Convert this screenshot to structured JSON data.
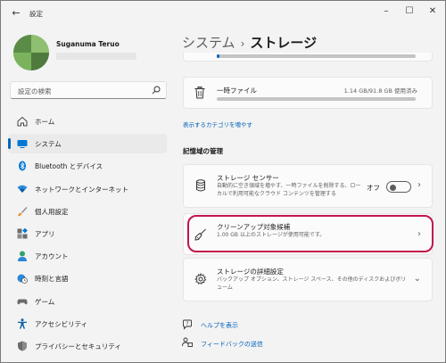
{
  "titlebar": {
    "back_glyph": "←",
    "title": "設定",
    "minimize_glyph": "–",
    "maximize_glyph": "☐",
    "close_glyph": "✕"
  },
  "profile": {
    "name": "Suganuma Teruo"
  },
  "search": {
    "placeholder": "設定の検索"
  },
  "nav": {
    "items": [
      {
        "label": "ホーム",
        "icon": "home-icon"
      },
      {
        "label": "システム",
        "icon": "system-icon",
        "active": true
      },
      {
        "label": "Bluetooth とデバイス",
        "icon": "bluetooth-icon"
      },
      {
        "label": "ネットワークとインターネット",
        "icon": "wifi-icon"
      },
      {
        "label": "個人用設定",
        "icon": "brush-icon"
      },
      {
        "label": "アプリ",
        "icon": "apps-icon"
      },
      {
        "label": "アカウント",
        "icon": "account-icon"
      },
      {
        "label": "時刻と言語",
        "icon": "globe-clock-icon"
      },
      {
        "label": "ゲーム",
        "icon": "gamepad-icon"
      },
      {
        "label": "アクセシビリティ",
        "icon": "accessibility-icon"
      },
      {
        "label": "プライバシーとセキュリティ",
        "icon": "shield-icon"
      }
    ]
  },
  "breadcrumb": {
    "parent": "システム",
    "separator": "›",
    "current": "ストレージ"
  },
  "storage": {
    "temp_files": {
      "title": "一時ファイル",
      "size": "1.14 GB/91.8 GB 使用済み"
    },
    "more_categories_link": "表示するカテゴリを増やす"
  },
  "management": {
    "heading": "記憶域の管理",
    "storage_sense": {
      "title": "ストレージ センサー",
      "description": "自動的に空き領域を増やす、一時ファイルを削除する、ローカルで利用可能なクラウド コンテンツを管理する",
      "toggle_label": "オフ",
      "toggle_on": false
    },
    "cleanup": {
      "title": "クリーンアップ対象候補",
      "description": "1.00 GB 以上のストレージが使用可能です。",
      "chevron": "›"
    },
    "advanced": {
      "title": "ストレージの詳細設定",
      "description": "バックアップ オプション、ストレージ スペース、その他のディスクおよびボリューム",
      "chevron": "⌄"
    }
  },
  "help": {
    "get_help": "ヘルプを表示",
    "feedback": "フィードバックの送信"
  },
  "colors": {
    "accent": "#0067c0",
    "highlight": "#c2154a"
  }
}
